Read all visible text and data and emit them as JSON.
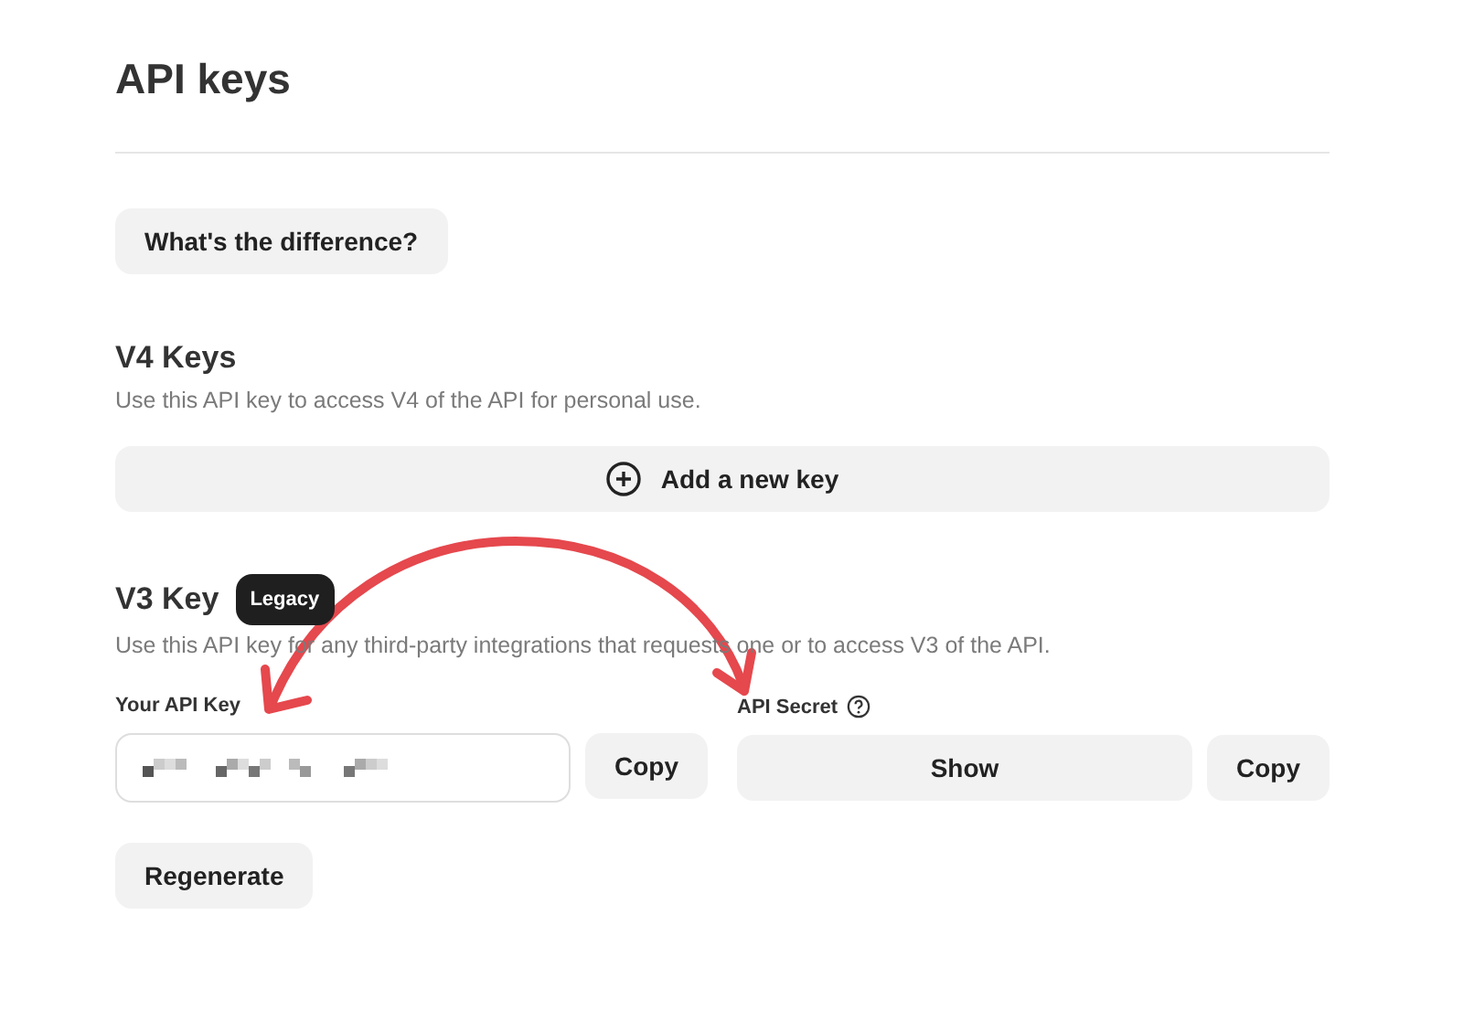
{
  "title": "API keys",
  "difference_button": "What's the difference?",
  "v4": {
    "heading": "V4 Keys",
    "description": "Use this API key to access V4 of the API for personal use.",
    "add_button": "Add a new key"
  },
  "v3": {
    "heading": "V3 Key",
    "badge": "Legacy",
    "description": "Use this API key for any third-party integrations that requests one or to access V3 of the API.",
    "key": {
      "label": "Your API Key",
      "copy_button": "Copy"
    },
    "secret": {
      "label": "API Secret",
      "show_button": "Show",
      "copy_button": "Copy"
    },
    "regenerate_button": "Regenerate"
  }
}
